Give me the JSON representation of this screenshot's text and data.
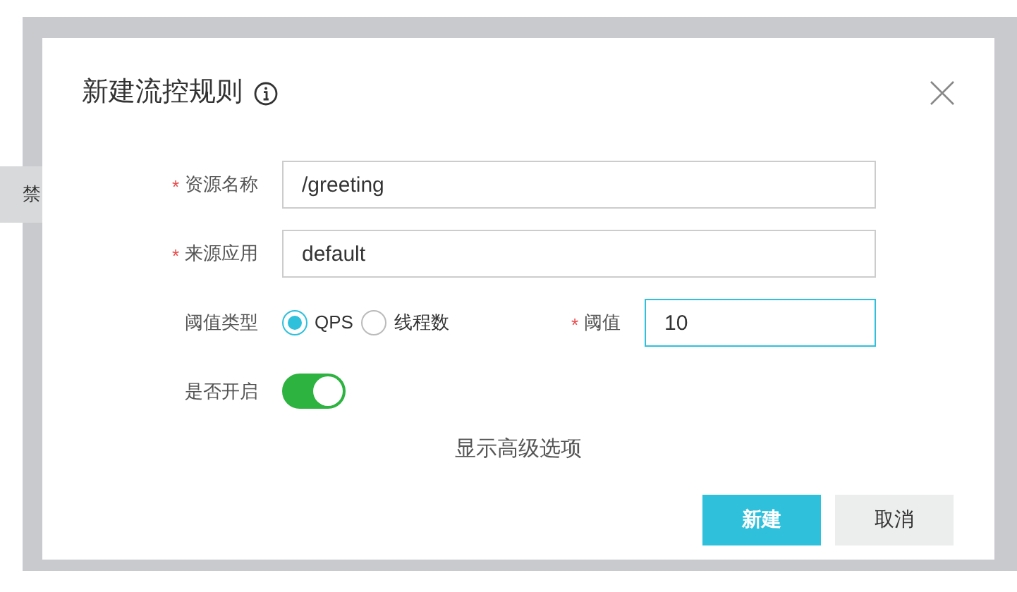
{
  "background": {
    "side_text": "禁"
  },
  "dialog": {
    "title": "新建流控规则",
    "fields": [
      {
        "kind": "text",
        "label": "资源名称",
        "required_mark": "*",
        "value": "/greeting"
      },
      {
        "kind": "text",
        "label": "来源应用",
        "required_mark": "*",
        "value": "default"
      }
    ],
    "threshold_type": {
      "label": "阈值类型",
      "options": [
        {
          "label": "QPS",
          "selected": true
        },
        {
          "label": "线程数",
          "selected": false
        }
      ]
    },
    "threshold": {
      "label": "阈值",
      "required_mark": "*",
      "value": "10",
      "focused": true
    },
    "enabled": {
      "label": "是否开启",
      "on": true
    },
    "advanced_link": "显示高级选项",
    "buttons": [
      {
        "label": "新建",
        "kind": "primary"
      },
      {
        "label": "取消",
        "kind": "secondary"
      }
    ]
  }
}
